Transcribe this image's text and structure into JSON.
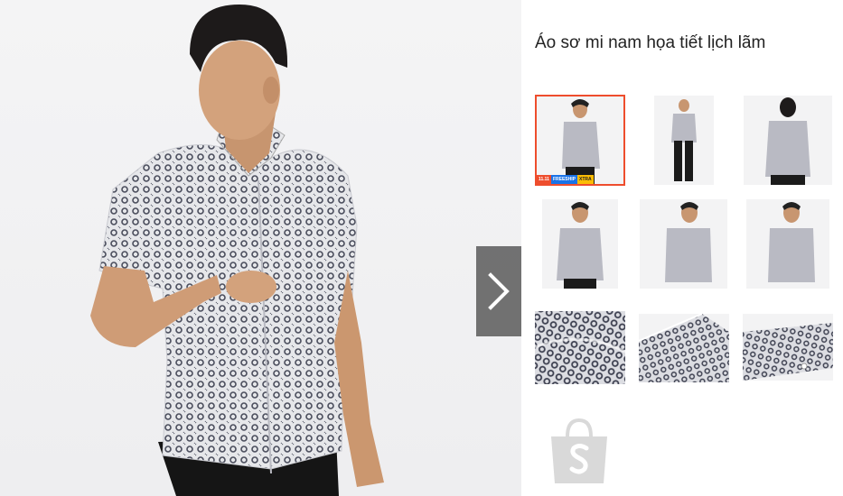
{
  "product": {
    "title": "Áo sơ mi nam họa tiết lịch lãm"
  },
  "gallery": {
    "selected_index": 0,
    "thumbnails": [
      {
        "kind": "model-front",
        "badge": {
          "date": "11.11",
          "text": "FREESHIP",
          "extra": "XTRA"
        }
      },
      {
        "kind": "model-full-body"
      },
      {
        "kind": "model-back"
      },
      {
        "kind": "model-front-close"
      },
      {
        "kind": "model-side"
      },
      {
        "kind": "model-hand"
      },
      {
        "kind": "fabric-closeup"
      },
      {
        "kind": "collar-closeup"
      },
      {
        "kind": "cuff-closeup"
      }
    ]
  },
  "icons": {
    "next": "chevron-right-icon",
    "shop": "shopee-bag-icon"
  },
  "colors": {
    "accent": "#ee4d2d",
    "overlay": "#5a5a5a",
    "placeholder": "#d9d9d9"
  }
}
